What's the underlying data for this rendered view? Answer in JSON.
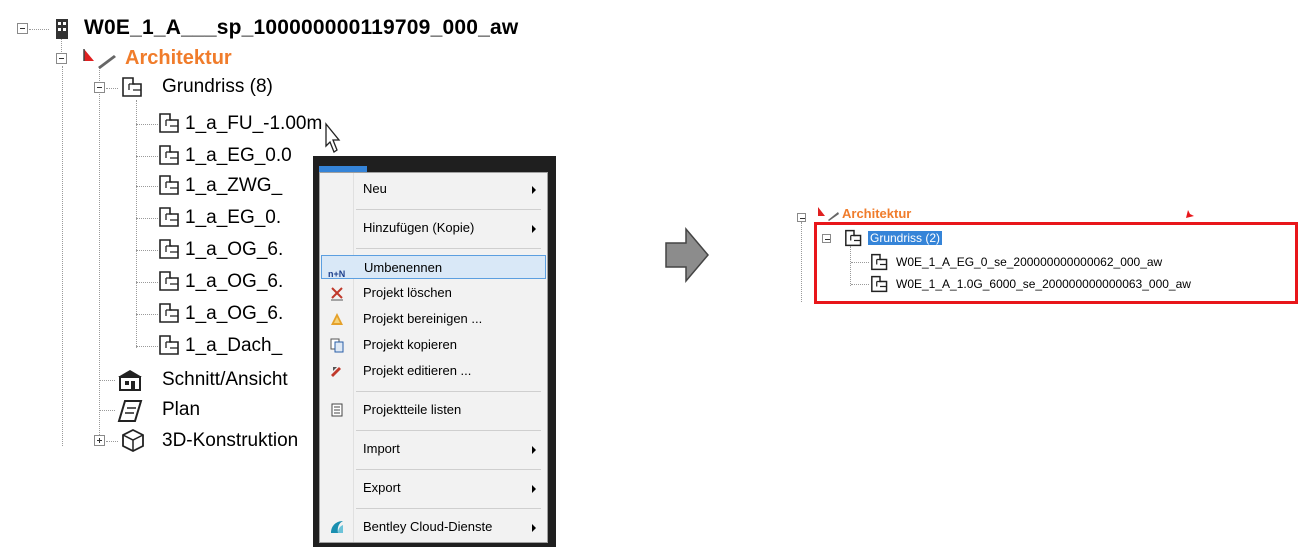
{
  "tree": {
    "root_label": "W0E_1_A___sp_100000000119709_000_aw",
    "arch_label": "Architektur",
    "grundriss_label": "Grundriss (8)",
    "floors": [
      "1_a_FU_-1.00m",
      "1_a_EG_0.0",
      "1_a_ZWG_",
      "1_a_EG_0.",
      "1_a_OG_6.",
      "1_a_OG_6.",
      "1_a_OG_6.",
      "1_a_Dach_"
    ],
    "schnitt_label": "Schnitt/Ansicht",
    "plan_label": "Plan",
    "konstruktion_label": "3D-Konstruktion"
  },
  "context_menu": {
    "items": [
      {
        "label": "Neu",
        "icon": "none",
        "submenu": true
      },
      {
        "label": "Hinzufügen (Kopie)",
        "icon": "none",
        "submenu": true
      },
      {
        "label": "Umbenennen",
        "icon": "rename-icon",
        "submenu": false,
        "highlighted": true
      },
      {
        "label": "Projekt löschen",
        "icon": "delete-x-icon",
        "submenu": false
      },
      {
        "label": "Projekt bereinigen ...",
        "icon": "clean-triangle-icon",
        "submenu": false
      },
      {
        "label": "Projekt kopieren",
        "icon": "copy-icon",
        "submenu": false
      },
      {
        "label": "Projekt editieren ...",
        "icon": "edit-icon",
        "submenu": false
      },
      {
        "label": "Projektteile listen",
        "icon": "list-icon",
        "submenu": false
      },
      {
        "label": "Import",
        "icon": "none",
        "submenu": true
      },
      {
        "label": "Export",
        "icon": "none",
        "submenu": true
      },
      {
        "label": "Bentley Cloud-Dienste",
        "icon": "bentley-cloud-icon",
        "submenu": true
      }
    ],
    "rename_icon_text": "n+N"
  },
  "result_panel": {
    "arch_label": "Architektur",
    "grundriss_label": "Grundriss (2)",
    "items": [
      "W0E_1_A_EG_0_se_200000000000062_000_aw",
      "W0E_1_A_1.0G_6000_se_200000000000063_000_aw"
    ]
  },
  "colors": {
    "architektur": "#f07c2b",
    "highlight_blue": "#3584d8",
    "menu_highlight": "#d9e8f7",
    "red_frame": "#e8161a",
    "arrow_gray": "#8c8c8c"
  }
}
